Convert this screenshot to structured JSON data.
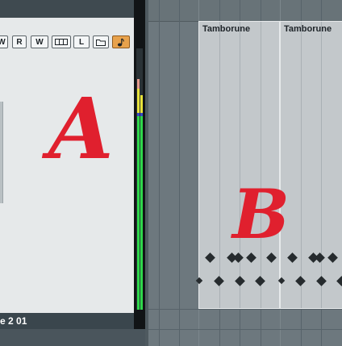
{
  "inspector": {
    "buttons": [
      {
        "name": "write-automation-button-partial",
        "label": "W",
        "active": false
      },
      {
        "name": "read-automation-button",
        "label": "R",
        "active": false
      },
      {
        "name": "write-automation-button",
        "label": "W",
        "active": false
      },
      {
        "name": "lanes-button",
        "label": "",
        "active": false
      },
      {
        "name": "lock-lane-button",
        "label": "L",
        "active": false
      },
      {
        "name": "folder-button",
        "label": "",
        "active": false
      },
      {
        "name": "timebase-button",
        "label": "",
        "active": true
      }
    ],
    "annotation": "A"
  },
  "status_bar": {
    "text": "e 2 01"
  },
  "arrange": {
    "annotation": "B",
    "parts": [
      {
        "name": "Tamborune"
      },
      {
        "name": "Tamborune"
      }
    ]
  },
  "colors": {
    "annotation": "#e0202e",
    "meter_green": "#2fd84b",
    "meter_yellow": "#e8e23a",
    "meter_red": "#e59a8c",
    "meter_blue": "#3a48c8",
    "active_button": "#e8a24c"
  }
}
